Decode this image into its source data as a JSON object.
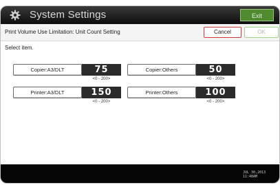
{
  "window": {
    "title": "System Settings",
    "exit_label": "Exit"
  },
  "header": {
    "title": "Print Volume Use Limitation: Unit Count Setting",
    "cancel_label": "Cancel",
    "ok_label": "OK"
  },
  "instruction": "Select item.",
  "settings": [
    {
      "label": "Copier:A3/DLT",
      "value": "75",
      "range": "<0 - 200>"
    },
    {
      "label": "Copier:Others",
      "value": "50",
      "range": "<0 - 200>"
    },
    {
      "label": "Printer:A3/DLT",
      "value": "150",
      "range": "<0 - 200>"
    },
    {
      "label": "Printer:Others",
      "value": "100",
      "range": "<0 - 200>"
    }
  ],
  "status": {
    "date": "JUL  30,2013",
    "time": "11:48AM"
  },
  "colors": {
    "exit_button": "#4f8a2e",
    "cancel_border": "#cc3b3b",
    "ok_border": "#9ed48a",
    "value_background": "#2b2b2b"
  },
  "icons": {
    "title": "gear-icon"
  }
}
